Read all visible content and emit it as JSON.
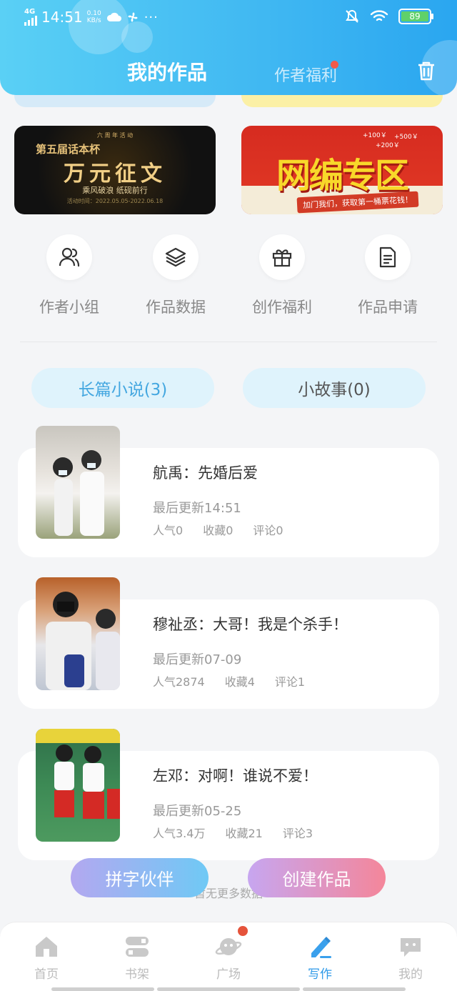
{
  "status_bar": {
    "network": "4G",
    "time": "14:51",
    "speed_value": "0.10",
    "speed_unit": "KB/s",
    "dots": "···",
    "battery": "89"
  },
  "header": {
    "title": "我的作品",
    "tab_secondary": "作者福利",
    "trash_icon": "trash-icon"
  },
  "banners": {
    "left": {
      "top_text": "六 周 年 活 动",
      "subtitle": "第五届话本杯",
      "title": "万元征文",
      "tagline": "乘风破浪 纸砚前行",
      "date": "活动时间：2022.05.05-2022.06.18"
    },
    "right": {
      "title": "网编专区",
      "tag": "加门我们，获取第一桶票花钱！",
      "prices": [
        "+100￥",
        "+500￥",
        "+200￥"
      ]
    }
  },
  "quick_actions": [
    {
      "label": "作者小组",
      "icon": "users-icon"
    },
    {
      "label": "作品数据",
      "icon": "layers-icon"
    },
    {
      "label": "创作福利",
      "icon": "gift-icon"
    },
    {
      "label": "作品申请",
      "icon": "document-icon"
    }
  ],
  "category_tabs": [
    {
      "label": "长篇小说(3)",
      "active": true
    },
    {
      "label": "小故事(0)",
      "active": false
    }
  ],
  "works": [
    {
      "title": "航禹：先婚后爱",
      "updated": "最后更新14:51",
      "popularity": "人气0",
      "favorites": "收藏0",
      "comments": "评论0"
    },
    {
      "title": "穆祉丞：大哥！我是个杀手！",
      "updated": "最后更新07-09",
      "popularity": "人气2874",
      "favorites": "收藏4",
      "comments": "评论1"
    },
    {
      "title": "左邓：对啊！谁说不爱！",
      "updated": "最后更新05-25",
      "popularity": "人气3.4万",
      "favorites": "收藏21",
      "comments": "评论3"
    }
  ],
  "floating_buttons": {
    "partner": "拼字伙伴",
    "create": "创建作品"
  },
  "no_more_text": "暂无更多数据",
  "bottom_nav": [
    {
      "label": "首页",
      "icon": "home-icon"
    },
    {
      "label": "书架",
      "icon": "bookshelf-icon"
    },
    {
      "label": "广场",
      "icon": "planet-icon"
    },
    {
      "label": "写作",
      "icon": "pen-icon",
      "active": true
    },
    {
      "label": "我的",
      "icon": "chat-icon"
    }
  ],
  "colors": {
    "header_gradient_start": "#5ad0f5",
    "header_gradient_end": "#2aa6f0",
    "accent": "#2f9ae8",
    "notification_dot": "#e5533b",
    "battery_fill": "#5fd16a"
  }
}
